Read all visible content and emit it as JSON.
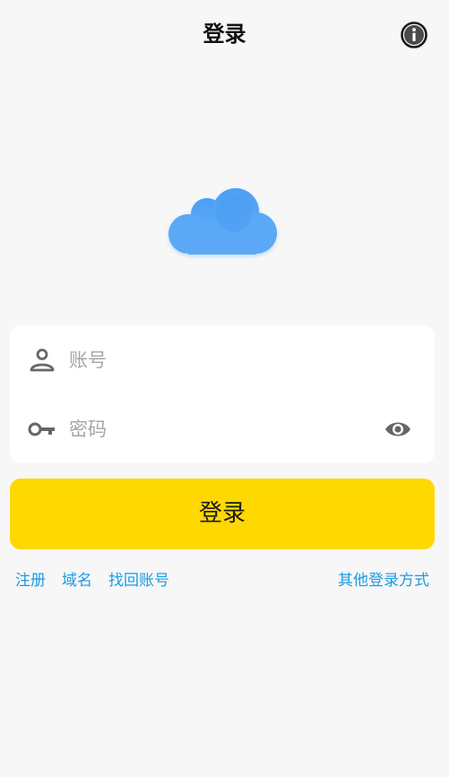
{
  "header": {
    "title": "登录"
  },
  "icons": {
    "info": "info-icon",
    "logo": "cloud-logo-icon",
    "account": "person-icon",
    "password": "key-icon",
    "visibility": "eye-icon"
  },
  "form": {
    "account_placeholder": "账号",
    "account_value": "",
    "password_placeholder": "密码",
    "password_value": ""
  },
  "login_button": {
    "label": "登录"
  },
  "links": {
    "register": "注册",
    "domain": "域名",
    "recover_account": "找回账号",
    "other_login": "其他登录方式"
  },
  "colors": {
    "accent_button": "#ffd800",
    "link": "#1a9be6",
    "logo": "#4aa0f5",
    "background": "#f7f7f7"
  }
}
